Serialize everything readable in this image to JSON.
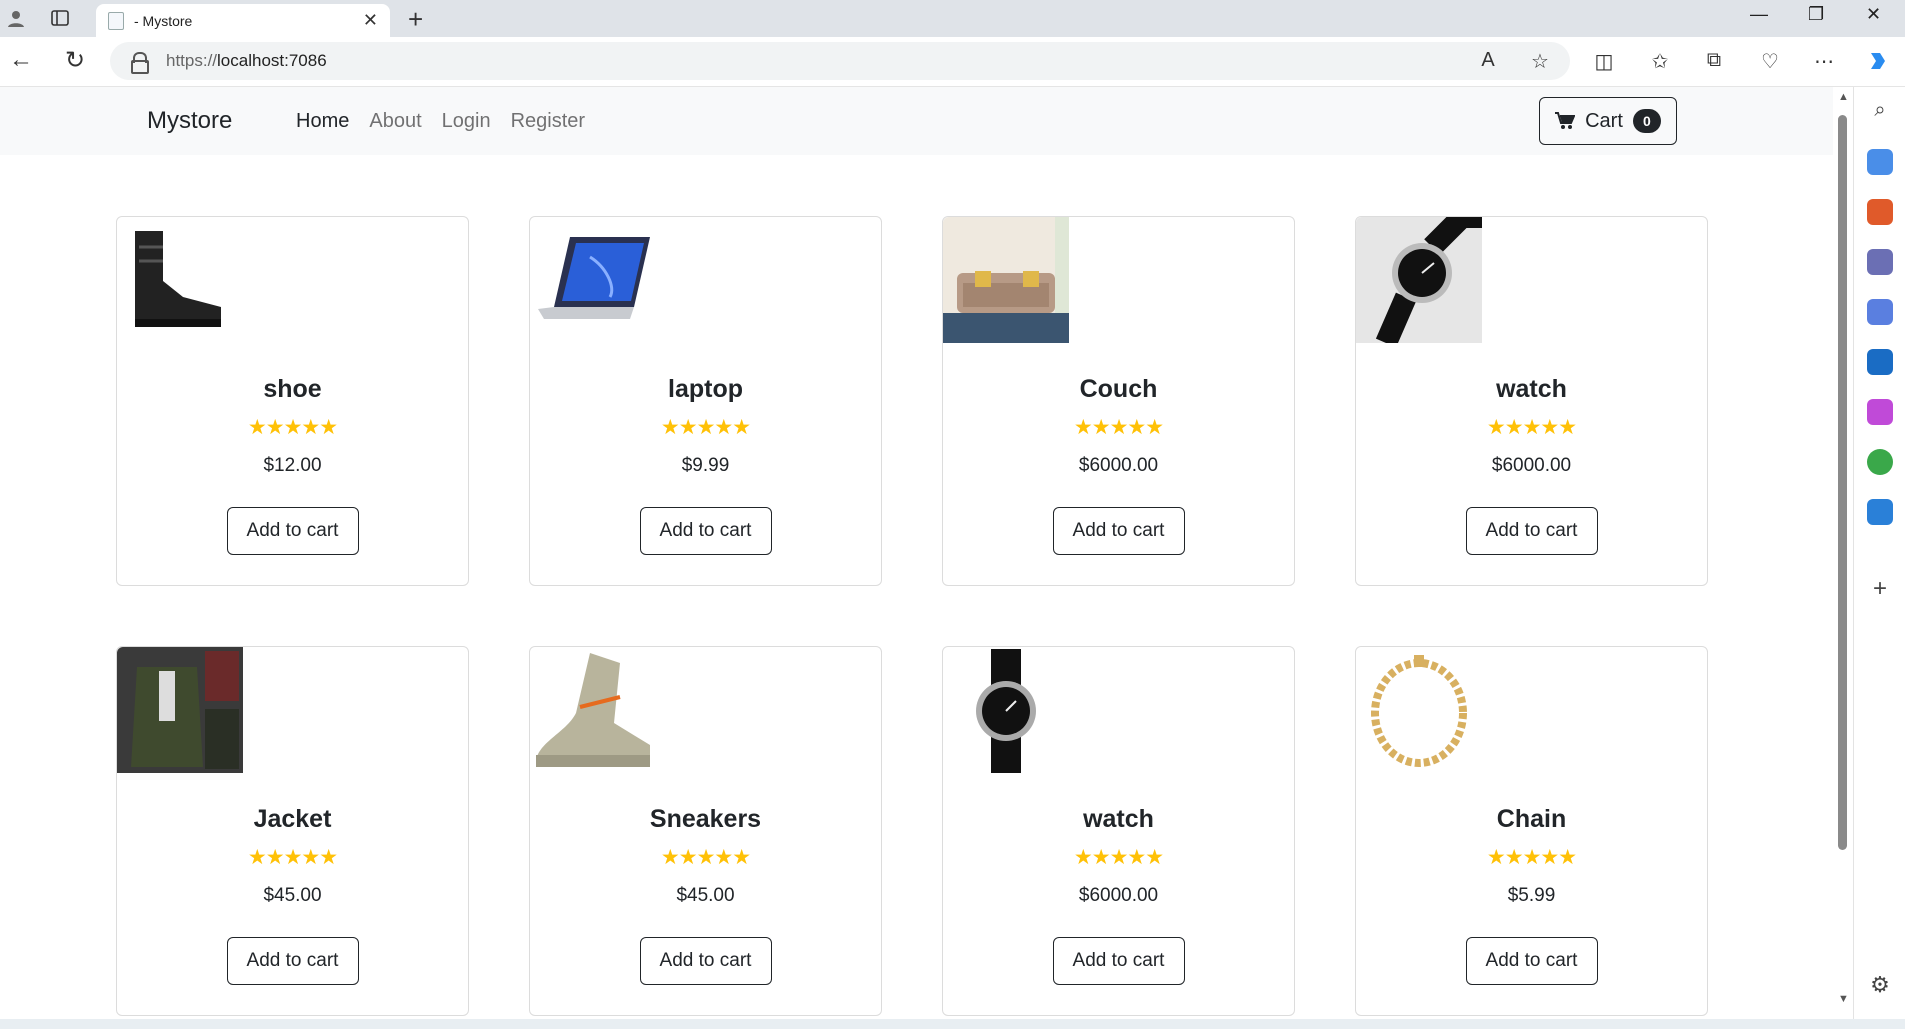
{
  "browser": {
    "tab_title": "- Mystore",
    "url_scheme": "https://",
    "url_host": "localhost:7086"
  },
  "navbar": {
    "brand": "Mystore",
    "links": [
      {
        "label": "Home",
        "active": true
      },
      {
        "label": "About",
        "active": false
      },
      {
        "label": "Login",
        "active": false
      },
      {
        "label": "Register",
        "active": false
      }
    ],
    "cart_label": "Cart",
    "cart_count": "0"
  },
  "products": [
    {
      "name": "shoe",
      "price": "$12.00",
      "rating": 5,
      "image": "boot-image",
      "button": "Add to cart"
    },
    {
      "name": "laptop",
      "price": "$9.99",
      "rating": 5,
      "image": "laptop-image",
      "button": "Add to cart"
    },
    {
      "name": "Couch",
      "price": "$6000.00",
      "rating": 5,
      "image": "couch-image",
      "button": "Add to cart"
    },
    {
      "name": "watch",
      "price": "$6000.00",
      "rating": 5,
      "image": "watch-image",
      "button": "Add to cart"
    },
    {
      "name": "Jacket",
      "price": "$45.00",
      "rating": 5,
      "image": "jacket-image",
      "button": "Add to cart"
    },
    {
      "name": "Sneakers",
      "price": "$45.00",
      "rating": 5,
      "image": "sneaker-image",
      "button": "Add to cart"
    },
    {
      "name": "watch",
      "price": "$6000.00",
      "rating": 5,
      "image": "watch-image",
      "button": "Add to cart"
    },
    {
      "name": "Chain",
      "price": "$5.99",
      "rating": 5,
      "image": "chain-image",
      "button": "Add to cart"
    }
  ],
  "colors": {
    "star": "#ffc107",
    "text": "#212529",
    "navbar_bg": "#f8f9fa"
  }
}
